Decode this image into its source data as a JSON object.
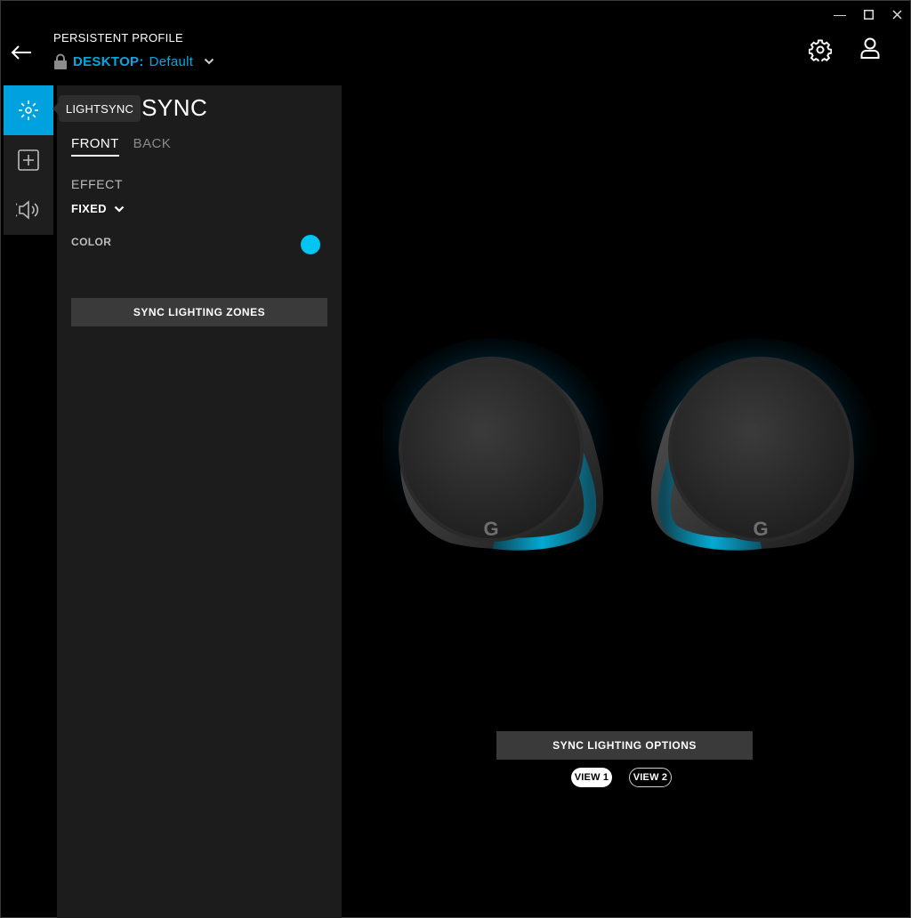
{
  "window": {
    "minimize_glyph": "—",
    "maximize_glyph": "☐",
    "close_glyph": "✕"
  },
  "header": {
    "profile_label": "PERSISTENT PROFILE",
    "profile_prefix": "DESKTOP:",
    "profile_name": "Default",
    "icons": [
      "back-arrow-icon",
      "lock-icon",
      "chevron-down-icon",
      "gear-icon",
      "user-icon"
    ]
  },
  "rail": {
    "items": [
      {
        "name": "lightsync",
        "icon": "sun-icon",
        "active": true
      },
      {
        "name": "assignments",
        "icon": "plus-square-icon",
        "active": false
      },
      {
        "name": "audio",
        "icon": "speaker-sound-icon",
        "active": false
      }
    ]
  },
  "tooltip": {
    "text": "LIGHTSYNC"
  },
  "panel": {
    "title": "LIGHTSYNC",
    "tabs": [
      {
        "label": "FRONT",
        "active": true
      },
      {
        "label": "BACK",
        "active": false
      }
    ],
    "effect_label": "EFFECT",
    "effect_value": "FIXED",
    "color_label": "COLOR",
    "color_value": "#00c5f0",
    "sync_zones_label": "SYNC LIGHTING ZONES"
  },
  "main": {
    "sync_options_label": "SYNC LIGHTING OPTIONS",
    "views": [
      {
        "label": "VIEW 1",
        "active": true
      },
      {
        "label": "VIEW 2",
        "active": false
      }
    ]
  },
  "colors": {
    "accent": "#00a1df",
    "panel_bg": "#1c1c1c",
    "button_bg": "#3a3a3a",
    "glow": "#00b8e6"
  }
}
